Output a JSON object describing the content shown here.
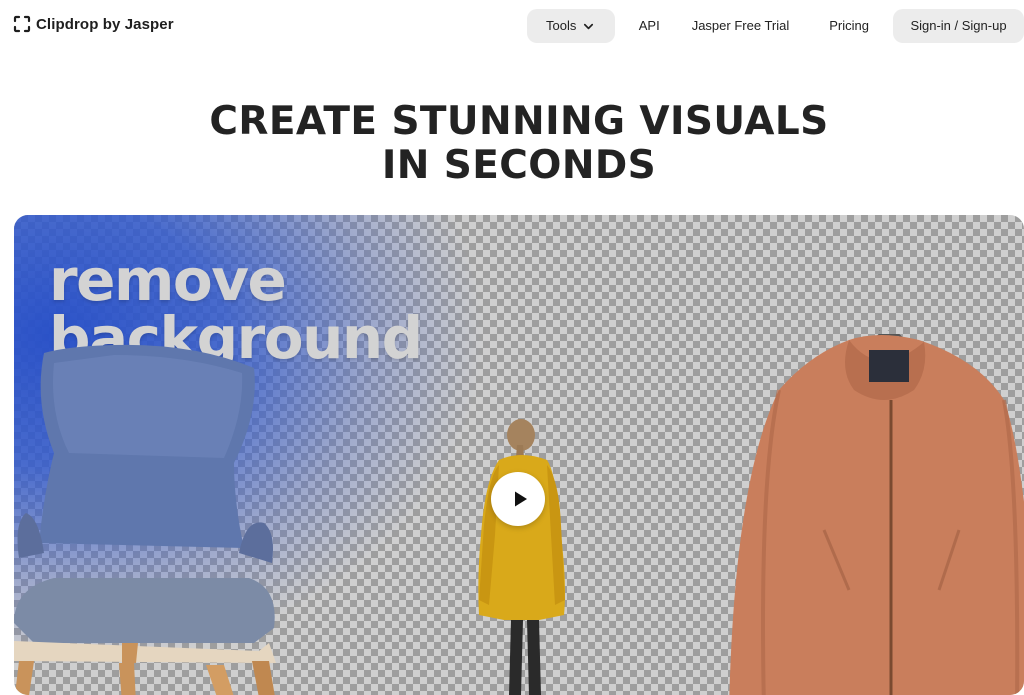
{
  "header": {
    "brand": "Clipdrop by Jasper",
    "nav": {
      "tools_label": "Tools",
      "api_label": "API",
      "trial_label": "Jasper Free Trial",
      "pricing_label": "Pricing",
      "signin_label": "Sign-in / Sign-up"
    }
  },
  "main": {
    "headline_line1": "CREATE STUNNING VISUALS",
    "headline_line2": "IN SECONDS",
    "hero": {
      "title_line1": "remove",
      "title_line2": "background",
      "play_icon": "play-icon",
      "items": [
        "chair",
        "person-yellow-raincoat",
        "jacket"
      ]
    }
  },
  "colors": {
    "accent_blue": "#2f54c8",
    "pill_bg": "#ececec",
    "text_dark": "#232323"
  }
}
